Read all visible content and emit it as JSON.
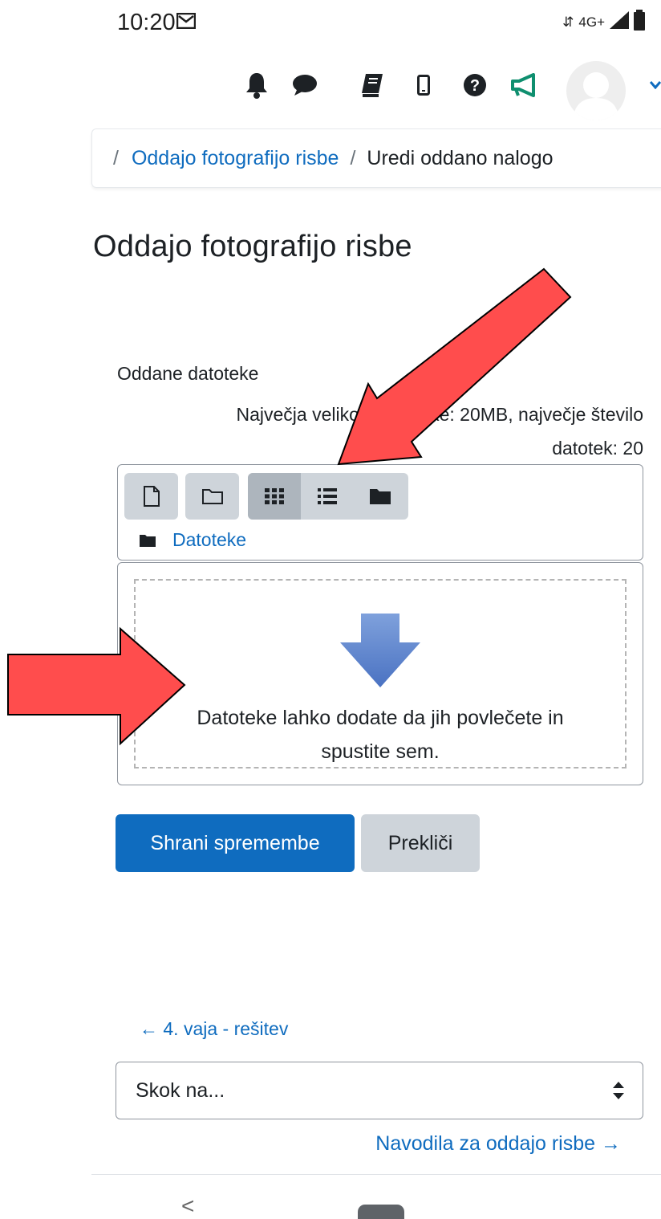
{
  "status_bar": {
    "time": "10:20",
    "network": "4G+",
    "icons": [
      "mail-icon",
      "signal-icon",
      "battery-icon"
    ]
  },
  "topnav": {
    "icons": [
      "bell-icon",
      "chat-icon",
      "book-icon",
      "mobile-icon",
      "help-icon",
      "megaphone-icon",
      "avatar",
      "caret-down-icon"
    ]
  },
  "breadcrumb": {
    "separator": "/",
    "items": [
      {
        "label": "Oddajo fotografijo risbe",
        "link": true
      },
      {
        "label": "Uredi oddano nalogo",
        "link": false
      }
    ]
  },
  "page": {
    "title": "Oddajo fotografijo risbe"
  },
  "submission": {
    "files_label": "Oddane datoteke",
    "limits_line1": "Največja velikost datoteke: 20MB, največje število",
    "limits_line2": "datotek: 20",
    "limits_visible_line1": "Največja velikost dato",
    "limits_visible_line1_end": "MB, največje število",
    "toolbar": {
      "buttons": [
        "add-file-icon",
        "create-folder-icon",
        "grid-view-icon",
        "list-view-icon",
        "tree-view-icon"
      ],
      "active_view": "grid"
    },
    "path_folder": "Datoteke",
    "drop_text": "Datoteke lahko dodate da jih povlečete in spustite sem."
  },
  "actions": {
    "save_label": "Shrani spremembe",
    "cancel_label": "Prekliči"
  },
  "navigation": {
    "prev_label": "← 4. vaja - rešitev",
    "jump_placeholder": "Skok na...",
    "next_label": "Navodila za oddajo risbe →"
  },
  "colors": {
    "link": "#0f6cbf",
    "primary": "#0f6cbf",
    "secondary": "#ced4da",
    "annotation_arrow": "#ff4d4d"
  }
}
